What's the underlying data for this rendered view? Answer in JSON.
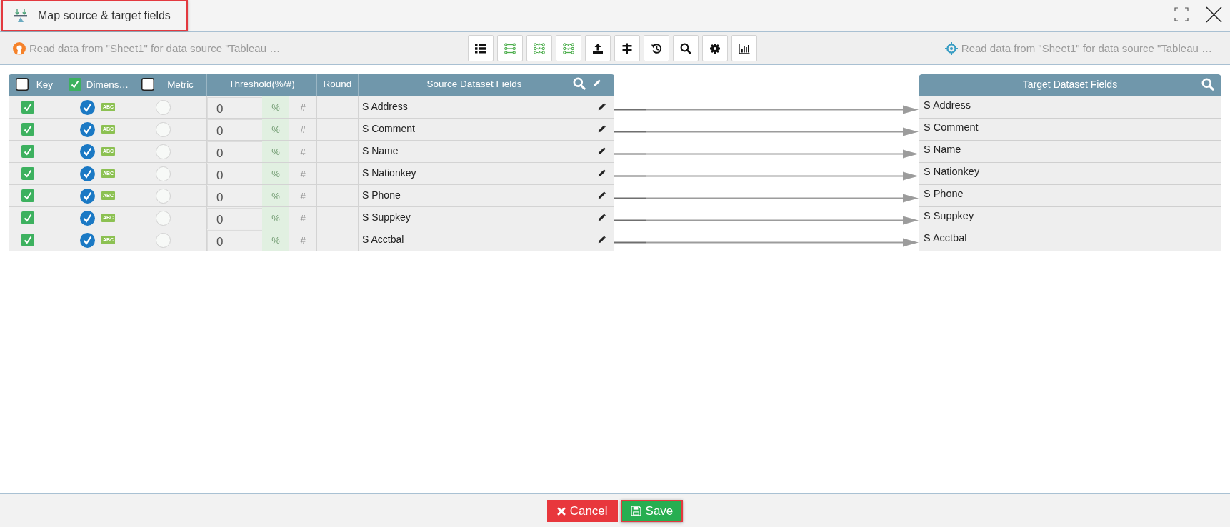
{
  "window": {
    "title": "Map source & target fields",
    "highlighted": true
  },
  "source_info": {
    "text": "Read data from \"Sheet1\" for data source \"Tableau …"
  },
  "toolbar": {
    "buttons": [
      {
        "kind": "list"
      },
      {
        "kind": "link_all"
      },
      {
        "kind": "unlink_all"
      },
      {
        "kind": "unlink_partial"
      },
      {
        "kind": "upload"
      },
      {
        "kind": "signpost"
      },
      {
        "kind": "history"
      },
      {
        "kind": "search"
      },
      {
        "kind": "settings"
      },
      {
        "kind": "chart"
      }
    ]
  },
  "target_info": {
    "text": "Read data from \"Sheet1\" for data source \"Tableau …"
  },
  "source_table": {
    "header": {
      "key": {
        "label": "Key",
        "checked": false
      },
      "dimension": {
        "label": "Dimens…",
        "checked": true
      },
      "metric": {
        "label": "Metric",
        "checked": false
      },
      "threshold": {
        "label": "Threshold(%/#)"
      },
      "round": {
        "label": "Round"
      },
      "field": {
        "label": "Source Dataset Fields"
      }
    },
    "rows": [
      {
        "key_checked": true,
        "dimension_selected": true,
        "type_label": "ABC",
        "metric_selected": false,
        "threshold": "0",
        "units": [
          {
            "label": "%",
            "selected": true
          },
          {
            "label": "#",
            "selected": false
          }
        ],
        "field": "S Address",
        "mapped": true
      },
      {
        "key_checked": true,
        "dimension_selected": true,
        "type_label": "ABC",
        "metric_selected": false,
        "threshold": "0",
        "units": [
          {
            "label": "%",
            "selected": true
          },
          {
            "label": "#",
            "selected": false
          }
        ],
        "field": "S Comment",
        "mapped": true
      },
      {
        "key_checked": true,
        "dimension_selected": true,
        "type_label": "ABC",
        "metric_selected": false,
        "threshold": "0",
        "units": [
          {
            "label": "%",
            "selected": true
          },
          {
            "label": "#",
            "selected": false
          }
        ],
        "field": "S Name",
        "mapped": true
      },
      {
        "key_checked": true,
        "dimension_selected": true,
        "type_label": "ABC",
        "metric_selected": false,
        "threshold": "0",
        "units": [
          {
            "label": "%",
            "selected": true
          },
          {
            "label": "#",
            "selected": false
          }
        ],
        "field": "S Nationkey",
        "mapped": true
      },
      {
        "key_checked": true,
        "dimension_selected": true,
        "type_label": "ABC",
        "metric_selected": false,
        "threshold": "0",
        "units": [
          {
            "label": "%",
            "selected": true
          },
          {
            "label": "#",
            "selected": false
          }
        ],
        "field": "S Phone",
        "mapped": true
      },
      {
        "key_checked": true,
        "dimension_selected": true,
        "type_label": "ABC",
        "metric_selected": false,
        "threshold": "0",
        "units": [
          {
            "label": "%",
            "selected": true
          },
          {
            "label": "#",
            "selected": false
          }
        ],
        "field": "S Suppkey",
        "mapped": true
      },
      {
        "key_checked": true,
        "dimension_selected": true,
        "type_label": "ABC",
        "metric_selected": false,
        "threshold": "0",
        "units": [
          {
            "label": "%",
            "selected": true
          },
          {
            "label": "#",
            "selected": false
          }
        ],
        "field": "S Acctbal",
        "mapped": true
      }
    ]
  },
  "target_table": {
    "header": "Target Dataset Fields",
    "rows": [
      "S Address",
      "S Comment",
      "S Name",
      "S Nationkey",
      "S Phone",
      "S Suppkey",
      "S Acctbal"
    ]
  },
  "footer": {
    "buttons": [
      {
        "kind": "cancel",
        "label": "Cancel",
        "highlighted": false
      },
      {
        "kind": "save",
        "label": "Save",
        "highlighted": true
      }
    ]
  }
}
